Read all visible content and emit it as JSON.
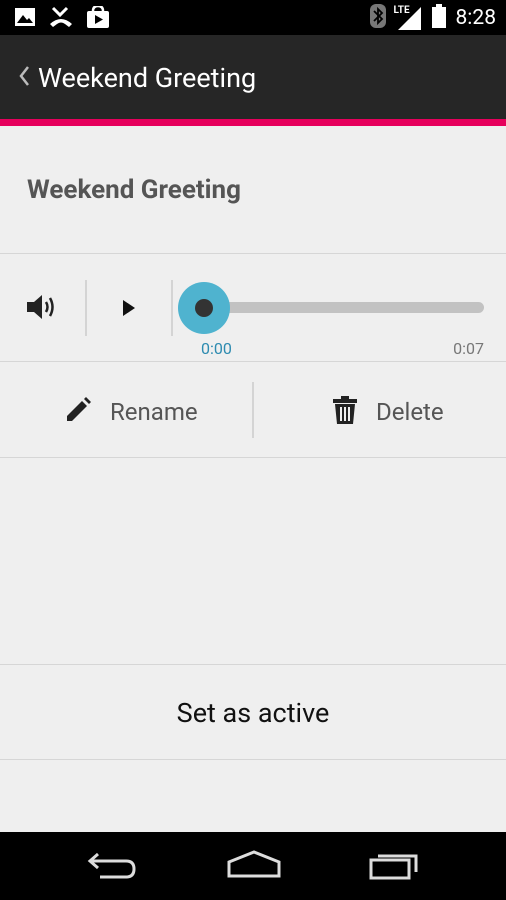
{
  "status_bar": {
    "time": "8:28",
    "network_label": "LTE",
    "icons": [
      "image-icon",
      "missed-call-icon",
      "play-store-icon",
      "bluetooth-icon",
      "signal-icon",
      "battery-icon"
    ]
  },
  "action_bar": {
    "title": "Weekend Greeting",
    "icons": [
      "back-chevron-icon"
    ]
  },
  "header": {
    "title": "Weekend Greeting"
  },
  "player": {
    "current_time": "0:00",
    "duration": "0:07",
    "progress": 0.0,
    "icons": [
      "volume-icon",
      "play-icon"
    ]
  },
  "actions": {
    "rename_label": "Rename",
    "delete_label": "Delete",
    "icons": [
      "pencil-icon",
      "trash-icon"
    ]
  },
  "set_active": {
    "label": "Set as active"
  },
  "nav_bar": {
    "icons": [
      "back-icon",
      "home-icon",
      "recents-icon"
    ]
  },
  "colors": {
    "accent": "#e6005c",
    "action_bar": "#262626",
    "slider_thumb": "#4fb3cf",
    "background": "#efefef"
  }
}
